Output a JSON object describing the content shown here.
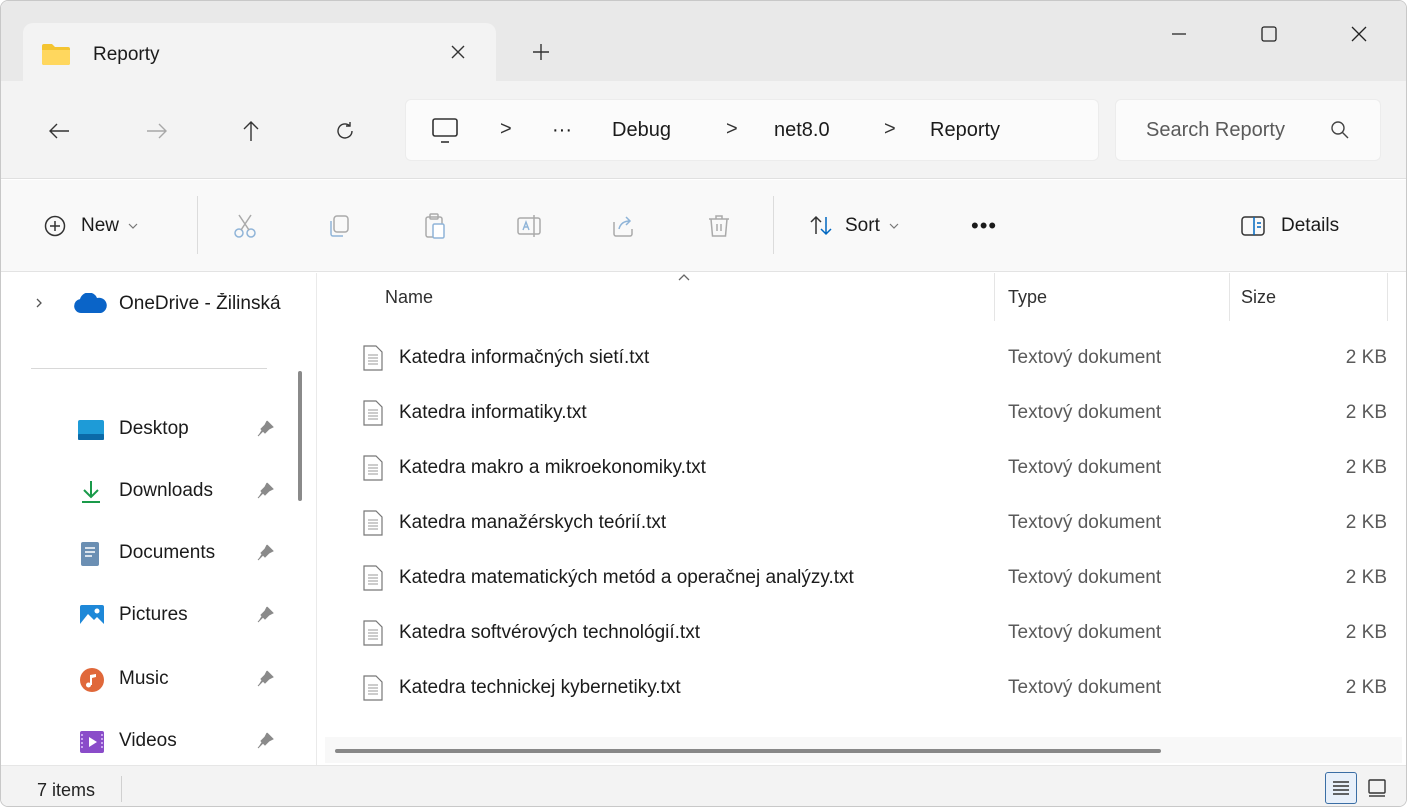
{
  "window": {
    "tab_title": "Reporty",
    "minimize_glyph": "—",
    "maximize_glyph": "☐",
    "close_glyph": "✕"
  },
  "nav": {
    "back_glyph": "←",
    "forward_glyph": "→",
    "up_glyph": "↑",
    "refresh_glyph": "↻",
    "breadcrumb": [
      "Debug",
      "net8.0",
      "Reporty"
    ],
    "overflow": "···",
    "separator": ">",
    "search_placeholder": "Search Reporty"
  },
  "commandbar": {
    "new_label": "New",
    "sort_label": "Sort",
    "more_label": "•••",
    "details_label": "Details"
  },
  "sidebar": {
    "onedrive": "OneDrive - Žilinská univerzita",
    "items": [
      {
        "label": "Desktop",
        "icon": "desktop-icon"
      },
      {
        "label": "Downloads",
        "icon": "downloads-icon"
      },
      {
        "label": "Documents",
        "icon": "documents-icon"
      },
      {
        "label": "Pictures",
        "icon": "pictures-icon"
      },
      {
        "label": "Music",
        "icon": "music-icon"
      },
      {
        "label": "Videos",
        "icon": "videos-icon"
      }
    ]
  },
  "columns": {
    "name": "Name",
    "type": "Type",
    "size": "Size"
  },
  "files": [
    {
      "name": "Katedra informačných sietí.txt",
      "type": "Textový dokument",
      "size": "2 KB"
    },
    {
      "name": "Katedra informatiky.txt",
      "type": "Textový dokument",
      "size": "2 KB"
    },
    {
      "name": "Katedra makro a mikroekonomiky.txt",
      "type": "Textový dokument",
      "size": "2 KB"
    },
    {
      "name": "Katedra manažérskych teórií.txt",
      "type": "Textový dokument",
      "size": "2 KB"
    },
    {
      "name": "Katedra matematických metód a operačnej analýzy.txt",
      "type": "Textový dokument",
      "size": "2 KB"
    },
    {
      "name": "Katedra softvérových technológií.txt",
      "type": "Textový dokument",
      "size": "2 KB"
    },
    {
      "name": "Katedra technickej kybernetiky.txt",
      "type": "Textový dokument",
      "size": "2 KB"
    }
  ],
  "status": {
    "items_count": "7 items"
  },
  "colors": {
    "accent": "#0067c0",
    "folder": "#f4c430"
  }
}
